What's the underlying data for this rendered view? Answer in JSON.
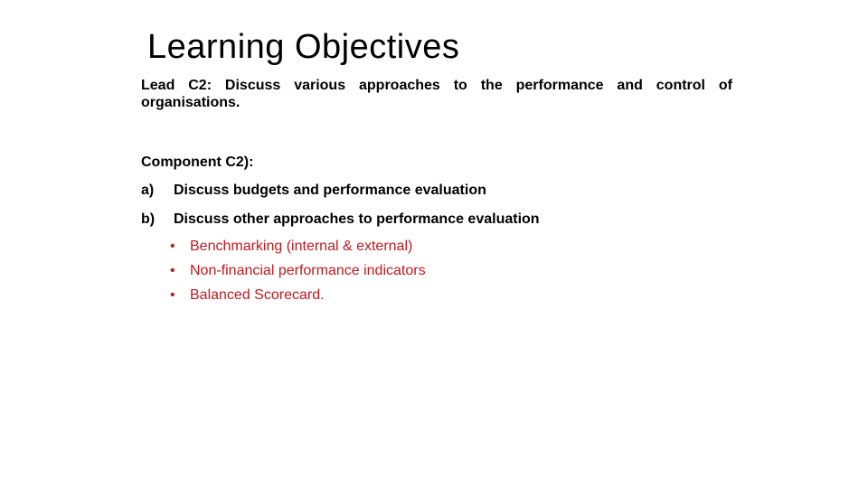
{
  "slide": {
    "title": "Learning Objectives",
    "lead": "Lead C2: Discuss various approaches to the performance and control of organisations.",
    "component_label": "Component C2):",
    "items": [
      {
        "marker": "a)",
        "text": "Discuss budgets and performance evaluation"
      },
      {
        "marker": "b)",
        "text": "Discuss other approaches to performance evaluation"
      }
    ],
    "sub_bullets": [
      {
        "bullet": "•",
        "text": "Benchmarking (internal & external)"
      },
      {
        "bullet": "•",
        "text": "Non-financial performance indicators"
      },
      {
        "bullet": "•",
        "text": "Balanced Scorecard."
      }
    ],
    "colors": {
      "text": "#000000",
      "sub_bullet_text": "#c0191e",
      "background": "#ffffff"
    }
  }
}
